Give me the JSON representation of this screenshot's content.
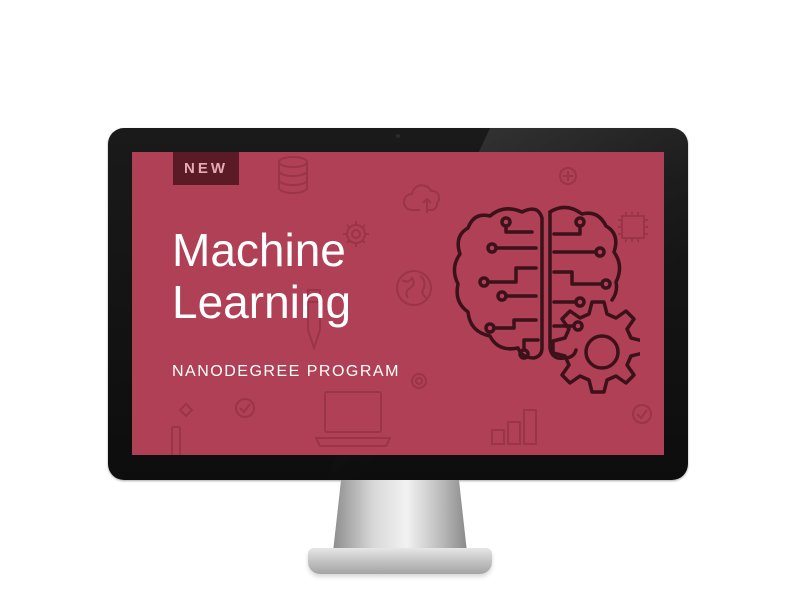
{
  "badge": {
    "label": "NEW"
  },
  "hero": {
    "title_line1": "Machine",
    "title_line2": "Learning",
    "subtitle": "NANODEGREE PROGRAM"
  },
  "colors": {
    "screen_background": "#b04055",
    "badge_background": "#5a1a26",
    "badge_text": "#e8a9b6",
    "text": "#ffffff",
    "illustration_stroke": "#3b1219",
    "background_icons": "#9a3447"
  },
  "icons": {
    "illustration": "brain-circuit-gear-icon",
    "background": [
      "database-icon",
      "cloud-upload-icon",
      "gear-icon",
      "globe-icon",
      "pen-icon",
      "laptop-icon",
      "bar-chart-icon",
      "checkmark-icon",
      "plus-circle-icon",
      "chip-icon"
    ]
  }
}
